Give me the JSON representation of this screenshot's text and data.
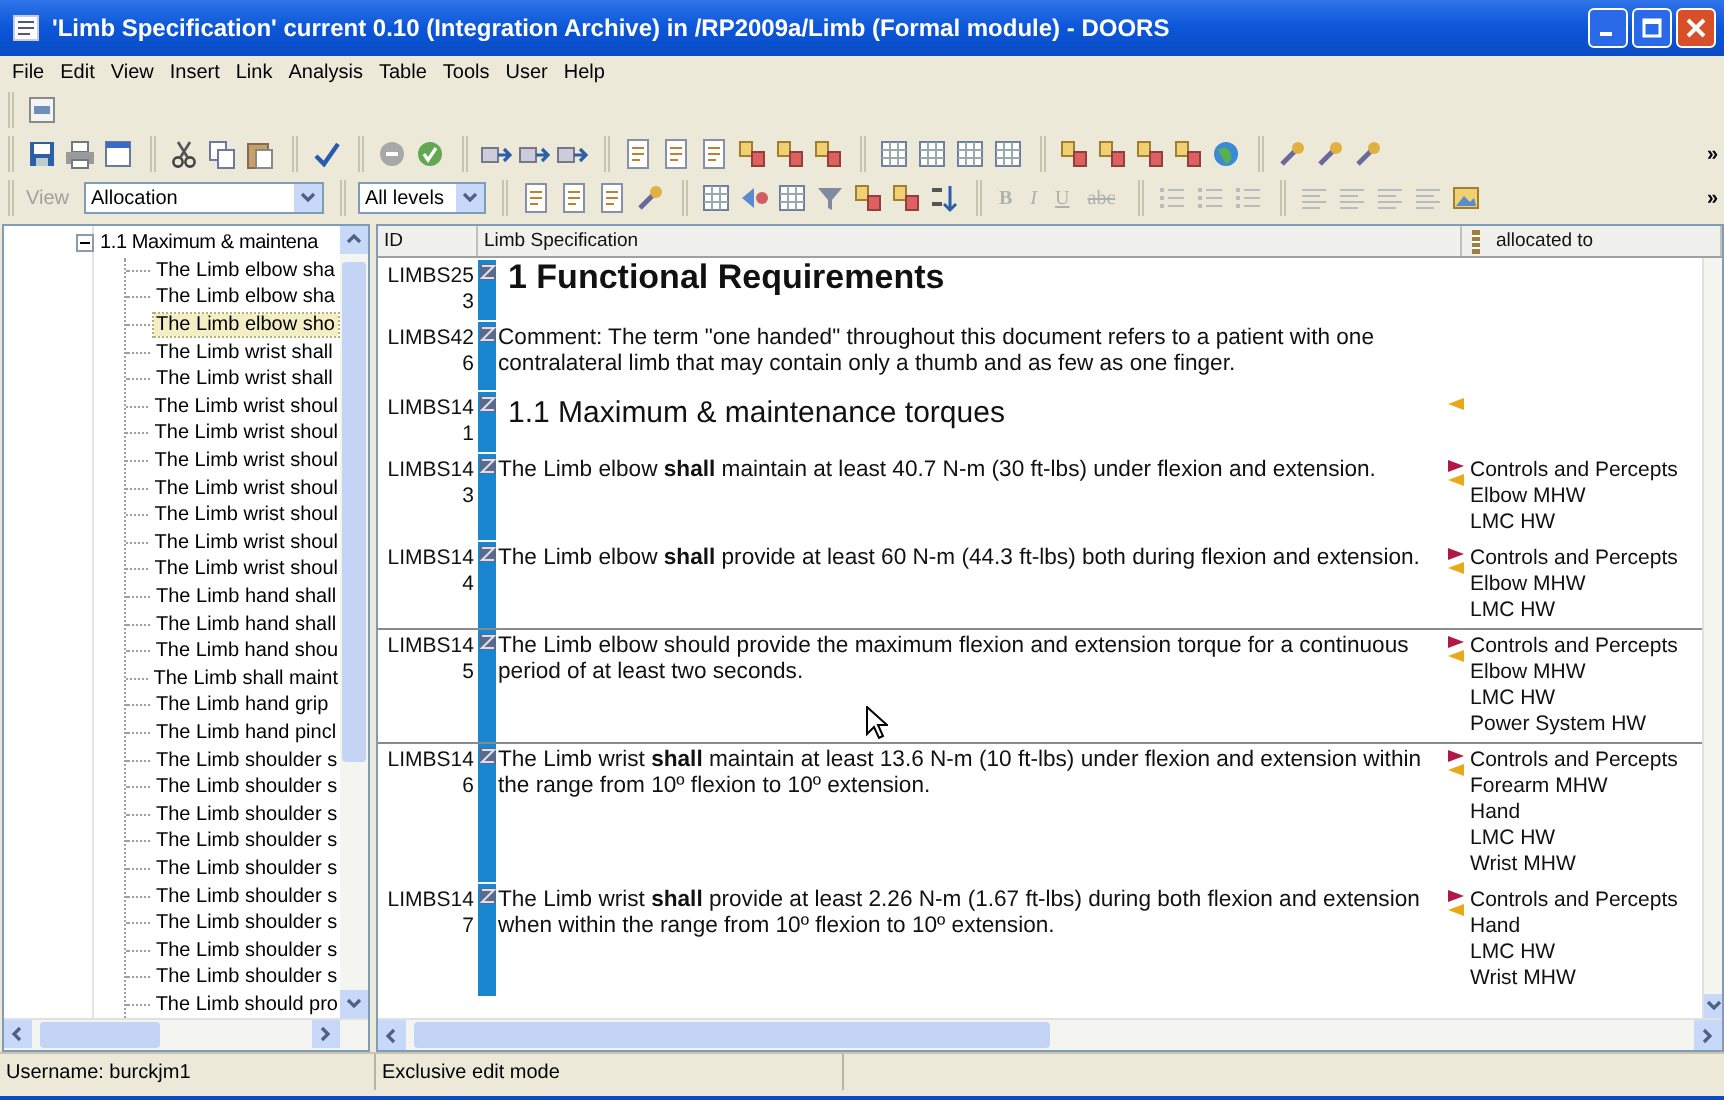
{
  "window": {
    "title": "'Limb Specification' current 0.10 (Integration Archive) in /RP2009a/Limb (Formal module) - DOORS"
  },
  "menu": [
    "File",
    "Edit",
    "View",
    "Insert",
    "Link",
    "Analysis",
    "Table",
    "Tools",
    "User",
    "Help"
  ],
  "toolbar_overflow": [
    "»",
    "»"
  ],
  "view_label": {
    "text": "View",
    "disabled": true
  },
  "view": "Allocation",
  "levels": "All levels",
  "format_buttons": [
    {
      "label": "B",
      "disabled": true
    },
    {
      "label": "I",
      "disabled": true
    },
    {
      "label": "U",
      "disabled": true
    },
    {
      "label": "abc",
      "disabled": true
    }
  ],
  "tree": {
    "items": [
      {
        "label": "1.1 Maximum & maintena",
        "expanded": true,
        "selected": false,
        "children": [
          {
            "label": "The Limb elbow sha",
            "selected": false
          },
          {
            "label": "The Limb elbow sha",
            "selected": false
          },
          {
            "label": "The Limb elbow sho",
            "selected": true
          },
          {
            "label": "The Limb wrist shall",
            "selected": false
          },
          {
            "label": "The Limb wrist shall",
            "selected": false
          },
          {
            "label": "The Limb wrist shoul",
            "selected": false
          },
          {
            "label": "The Limb wrist shoul",
            "selected": false
          },
          {
            "label": "The Limb wrist shoul",
            "selected": false
          },
          {
            "label": "The Limb wrist shoul",
            "selected": false
          },
          {
            "label": "The Limb wrist shoul",
            "selected": false
          },
          {
            "label": "The Limb wrist shoul",
            "selected": false
          },
          {
            "label": "The Limb wrist shoul",
            "selected": false
          },
          {
            "label": "The Limb hand shall",
            "selected": false
          },
          {
            "label": "The Limb hand shall",
            "selected": false
          },
          {
            "label": "The Limb hand shou",
            "selected": false
          },
          {
            "label": "The Limb shall maint",
            "selected": false
          },
          {
            "label": "The Limb hand grip",
            "selected": false
          },
          {
            "label": "The Limb hand pincl",
            "selected": false
          },
          {
            "label": "The Limb shoulder s",
            "selected": false
          },
          {
            "label": "The Limb shoulder s",
            "selected": false
          },
          {
            "label": "The Limb shoulder s",
            "selected": false
          },
          {
            "label": "The Limb shoulder s",
            "selected": false
          },
          {
            "label": "The Limb shoulder s",
            "selected": false
          },
          {
            "label": "The Limb shoulder s",
            "selected": false
          },
          {
            "label": "The Limb shoulder s",
            "selected": false
          },
          {
            "label": "The Limb shoulder s",
            "selected": false
          },
          {
            "label": "The Limb shoulder s",
            "selected": false
          },
          {
            "label": "The Limb should pro",
            "selected": false
          }
        ]
      }
    ]
  },
  "table": {
    "columns": [
      "ID",
      "Limb Specification",
      "allocated to"
    ],
    "rows": [
      {
        "id": "LIMBS253",
        "kind": "heading1",
        "text": "1 Functional Requirements",
        "separator": false,
        "in_link": false,
        "out_link": false
      },
      {
        "id": "LIMBS426",
        "kind": "comment",
        "text": "Comment: The term \"one handed\" throughout this document refers to a patient with one contralateral limb that may contain only a thumb and as few as one finger.",
        "separator": false,
        "in_link": false,
        "out_link": false
      },
      {
        "id": "LIMBS141",
        "kind": "heading2",
        "text": "1.1 Maximum & maintenance torques",
        "separator": false,
        "in_link": true,
        "out_link": false
      },
      {
        "id": "LIMBS143",
        "kind": "requirement",
        "text": "The Limb elbow **shall** maintain at least 40.7 N-m (30 ft-lbs) under flexion and extension.",
        "separator": false,
        "in_link": true,
        "out_link": true,
        "allocated": [
          "Controls and Percepts",
          "Elbow MHW",
          "LMC HW"
        ]
      },
      {
        "id": "LIMBS144",
        "kind": "requirement",
        "text": "The Limb elbow **shall** provide at least 60 N-m (44.3 ft-lbs) both during flexion and extension.",
        "separator": false,
        "in_link": true,
        "out_link": true,
        "allocated": [
          "Controls and Percepts",
          "Elbow MHW",
          "LMC HW"
        ]
      },
      {
        "id": "LIMBS145",
        "kind": "requirement",
        "text": "The Limb elbow should provide the maximum flexion and extension torque for a continuous period of at least two seconds.",
        "separator": true,
        "in_link": true,
        "out_link": true,
        "allocated": [
          "Controls and Percepts",
          "Elbow MHW",
          "LMC HW",
          "Power System HW"
        ]
      },
      {
        "id": "LIMBS146",
        "kind": "requirement",
        "text": "The Limb wrist **shall** maintain at least 13.6 N-m (10 ft-lbs) under flexion and extension within the range from 10º flexion to 10º extension.",
        "separator": true,
        "in_link": true,
        "out_link": true,
        "allocated": [
          "Controls and Percepts",
          "Forearm MHW",
          "Hand",
          "LMC HW",
          "Wrist MHW"
        ]
      },
      {
        "id": "LIMBS147",
        "kind": "requirement",
        "text": "The Limb wrist **shall** provide at least 2.26 N-m (1.67 ft-lbs) during both flexion and extension when within the range from 10º flexion to 10º extension.",
        "separator": false,
        "in_link": true,
        "out_link": true,
        "allocated": [
          "Controls and Percepts",
          "Hand",
          "LMC HW",
          "Wrist MHW"
        ]
      }
    ]
  },
  "status_bar": [
    "Username: burckjm1",
    "Exclusive edit mode"
  ]
}
